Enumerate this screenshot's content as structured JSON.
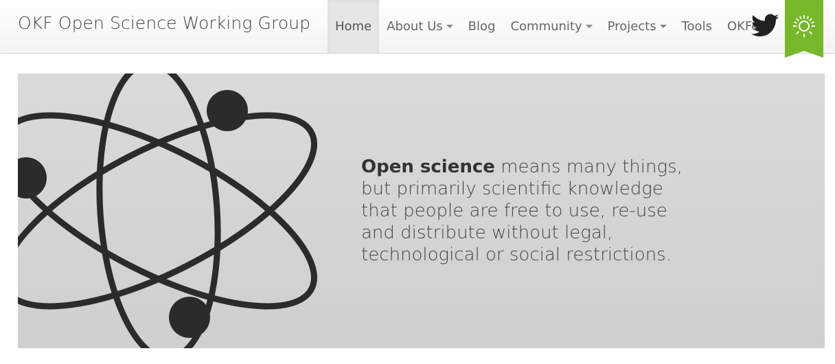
{
  "brand": {
    "title": "OKF Open Science Working Group"
  },
  "nav": {
    "items": [
      {
        "label": "Home",
        "active": true,
        "dropdown": false
      },
      {
        "label": "About Us",
        "active": false,
        "dropdown": true
      },
      {
        "label": "Blog",
        "active": false,
        "dropdown": false
      },
      {
        "label": "Community",
        "active": false,
        "dropdown": true
      },
      {
        "label": "Projects",
        "active": false,
        "dropdown": true
      },
      {
        "label": "Tools",
        "active": false,
        "dropdown": false
      },
      {
        "label": "OKFest",
        "active": false,
        "dropdown": false
      }
    ],
    "twitter_icon": "twitter-bird-icon",
    "badge_icon": "okf-logo-icon",
    "badge_color": "#76b82a"
  },
  "hero": {
    "bold": "Open science",
    "text": " means many things, but primarily scientific knowledge that people are free to use, re-use and distribute without legal, technological or social restrictions.",
    "image_icon": "atom-icon"
  }
}
